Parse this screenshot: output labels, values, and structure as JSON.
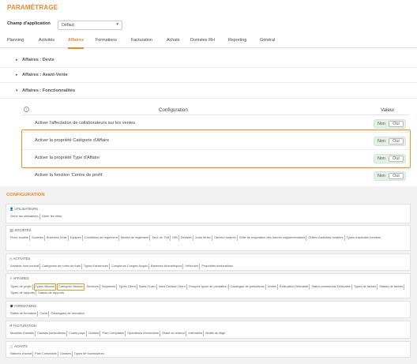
{
  "header": {
    "title": "PARAMÉTRAGE",
    "champ_label": "Champ d'application",
    "champ_value": "Défaut"
  },
  "tabs": [
    "Planning",
    "Activités",
    "Affaires",
    "Formations",
    "Facturation",
    "Achats",
    "Données RH",
    "Reporting",
    "Général"
  ],
  "active_tab": "Affaires",
  "accordions": [
    {
      "label": "Affaires : Devis",
      "arrow": "▸"
    },
    {
      "label": "Affaires : Avant-Vente",
      "arrow": "▸"
    },
    {
      "label": "Affaires : Fonctionnalités",
      "arrow": "▾"
    }
  ],
  "config_table": {
    "info_icon": "i",
    "col_config": "Configuration",
    "col_value": "Valeur",
    "rows": [
      {
        "label": "Activer l'affectation de collaborateurs sur les ventes",
        "off": "Non",
        "on": "Oui"
      },
      {
        "label": "Activer la propriété Catégorie d'Affaire",
        "off": "Non",
        "on": "Oui"
      },
      {
        "label": "Activer la propriété Type d'Affaire",
        "off": "Non",
        "on": "Oui"
      },
      {
        "label": "Activer la fonction 'Centre de profit'",
        "off": "Non",
        "on": "Oui"
      }
    ]
  },
  "configuration": {
    "title": "CONFIGURATION",
    "sections": [
      {
        "icon": "person-icon",
        "glyph": "👤",
        "title": "UTILISATEURS",
        "links": [
          "Gérer les utilisateurs",
          "Gérer les rôles"
        ]
      },
      {
        "icon": "building-icon",
        "glyph": "🏢",
        "title": "SOCIÉTÉS",
        "links": [
          "Fiche société",
          "Sociétés",
          "Business Units",
          "Equipes",
          "Conditions de règlement",
          "Modes de règlement",
          "Taux de TVA",
          "RIB",
          "Devises",
          "Jours fériés",
          "Tâches horaires",
          "Grille de majoration des heures supplémentaires",
          "Grilles d'activités horaires",
          "Types d'activités horaires"
        ]
      },
      {
        "icon": "clock-icon",
        "glyph": "◷",
        "title": "ACTIVITÉS",
        "links": [
          "Activités hors contrat",
          "Catégories de notes de frais",
          "Types d'absences",
          "Compteurs Congés Acquis",
          "Barèmes kilométriques",
          "Véhicules",
          "Propriétés déclaratives"
        ]
      },
      {
        "icon": "arrow-icon",
        "glyph": "↗",
        "title": "AFFAIRES",
        "links": [
          "Types de projet",
          "Types Mission",
          "Catégorie Mission",
          "Secteurs",
          "Segments",
          "Types Client",
          "Sales Chain",
          "Infos Contact Client",
          "Groupes types de prestation",
          "Catalogue de prestations",
          "Unités",
          "Évaluation Délivrable",
          "Statut commercial Délivrable",
          "Types de tâches",
          "Statuts de tâches",
          "Types de rapports",
          "Statuts de rapports"
        ],
        "highlighted": [
          "Types Mission",
          "Catégorie Mission"
        ]
      },
      {
        "icon": "mortarboard-icon",
        "glyph": "🎓",
        "title": "FORMATIONS",
        "links": [
          "Salles de formation",
          "Coûts",
          "Catalogues de formation"
        ]
      },
      {
        "icon": "invoice-icon",
        "glyph": "🗎",
        "title": "FACTURATION",
        "links": [
          "Modèles d'emails",
          "Clauses particulières",
          "Codes pays",
          "Classes",
          "Plan Comptable",
          "Opérations d'inventaire",
          "Statut de relance",
          "Intervalles",
          "Motifs de litige"
        ]
      },
      {
        "icon": "cart-icon",
        "glyph": "🛒",
        "title": "ACHATS",
        "links": [
          "Natures d'achat",
          "Plan Comptable",
          "Classes",
          "Types de fournisseurs"
        ]
      }
    ]
  }
}
